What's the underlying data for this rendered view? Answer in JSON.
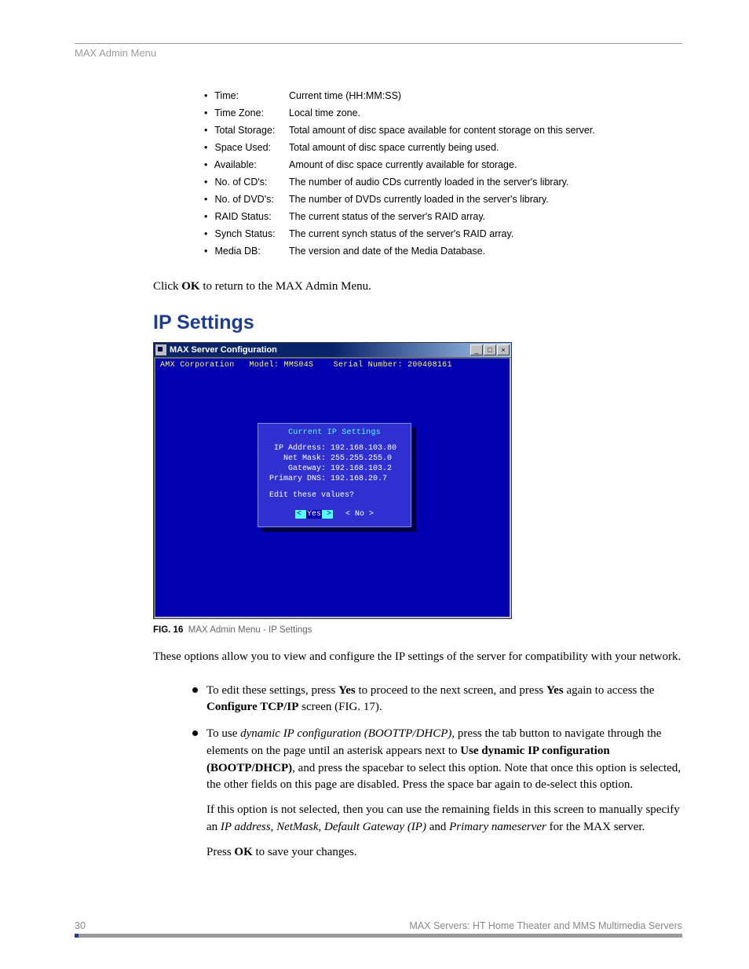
{
  "header": {
    "section": "MAX Admin Menu"
  },
  "definitions": [
    {
      "term": "Time:",
      "desc": "Current time (HH:MM:SS)"
    },
    {
      "term": "Time Zone:",
      "desc": "Local time zone."
    },
    {
      "term": "Total Storage:",
      "desc": "Total amount of disc space available for content storage on this server."
    },
    {
      "term": "Space Used:",
      "desc": "Total amount of disc space currently being used."
    },
    {
      "term": "Available:",
      "desc": "Amount of disc space currently available for storage."
    },
    {
      "term": "No. of CD's:",
      "desc": "The number of audio CDs currently loaded in the server's library."
    },
    {
      "term": "No. of DVD's:",
      "desc": "The number of DVDs currently loaded in the server's library."
    },
    {
      "term": "RAID Status:",
      "desc": "The current status of the server's RAID array."
    },
    {
      "term": "Synch Status:",
      "desc": "The current synch status of the server's RAID array."
    },
    {
      "term": "Media DB:",
      "desc": "The version and date of the Media Database."
    }
  ],
  "para_click": {
    "pre": "Click ",
    "ok": "OK",
    "post": " to return to the MAX Admin Menu."
  },
  "heading": "IP Settings",
  "window": {
    "title": "MAX Server Configuration",
    "header": {
      "corp": "AMX Corporation",
      "model_label": "Model: ",
      "model": "MMS04S",
      "serial_label": "Serial Number: ",
      "serial": "200408161"
    },
    "dialog": {
      "title": "Current IP Settings",
      "rows": [
        {
          "label": "  IP Address:",
          "value": "192.168.103.80"
        },
        {
          "label": "    Net Mask:",
          "value": "255.255.255.0"
        },
        {
          "label": "     Gateway:",
          "value": "192.168.103.2"
        },
        {
          "label": " Primary DNS:",
          "value": "192.168.20.7"
        }
      ],
      "prompt": "Edit these values?",
      "yes": "Yes",
      "no": "No"
    }
  },
  "figure": {
    "num": "FIG. 16",
    "caption": "MAX Admin Menu - IP Settings"
  },
  "para_intro": "These options allow you to view and configure the IP settings of the server for compatibility with your network.",
  "bullets": {
    "b1": {
      "t1": "To edit these settings, press ",
      "yes": "Yes",
      "t2": " to proceed to the next screen, and press ",
      "yes2": "Yes",
      "t3": " again to access the ",
      "cfg": "Configure TCP/IP",
      "t4": " screen (FIG. 17)."
    },
    "b2": {
      "t1": "To use ",
      "dyn": "dynamic IP configuration (BOOTTP/DHCP)",
      "t2": ", press the tab button to navigate through the elements on the page until an asterisk appears next to ",
      "use": "Use dynamic IP configuration (BOOTP/DHCP)",
      "t3": ", and press the spacebar to select this option. Note that once this option is selected, the other fields on this page are disabled. Press the space bar again to de-select this option.",
      "f1a": "If this option is not selected, then you can use the remaining fields in this screen to manually specify an ",
      "ip": "IP address",
      "c1": ", ",
      "nm": "NetMask",
      "c2": ", ",
      "gw": "Default Gateway (IP)",
      "and": " and ",
      "ns": "Primary nameserver",
      "f1b": " for the MAX server.",
      "f2a": "Press ",
      "ok": "OK",
      "f2b": " to save your changes."
    }
  },
  "footer": {
    "page": "30",
    "title": "MAX Servers: HT Home Theater and MMS Multimedia Servers"
  }
}
